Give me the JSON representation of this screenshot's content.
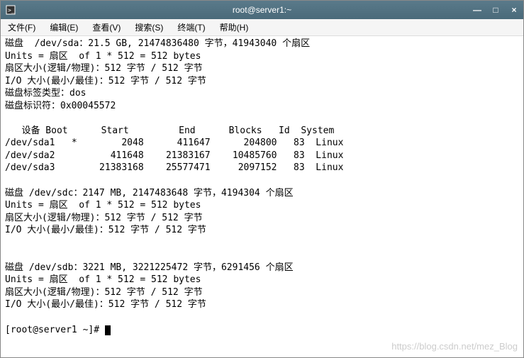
{
  "titlebar": {
    "title": "root@server1:~"
  },
  "menu": {
    "file": "文件(F)",
    "edit": "编辑(E)",
    "view": "查看(V)",
    "search": "搜索(S)",
    "terminal": "终端(T)",
    "help": "帮助(H)"
  },
  "terminal_lines": {
    "l0": "磁盘  /dev/sda：21.5 GB, 21474836480 字节，41943040 个扇区",
    "l1": "Units = 扇区  of 1 * 512 = 512 bytes",
    "l2": "扇区大小(逻辑/物理)：512 字节 / 512 字节",
    "l3": "I/O 大小(最小/最佳)：512 字节 / 512 字节",
    "l4": "磁盘标签类型：dos",
    "l5": "磁盘标识符：0x00045572",
    "l6": "",
    "l7": "   设备 Boot      Start         End      Blocks   Id  System",
    "l8": "/dev/sda1   *        2048      411647      204800   83  Linux",
    "l9": "/dev/sda2          411648    21383167    10485760   83  Linux",
    "l10": "/dev/sda3        21383168    25577471     2097152   83  Linux",
    "l11": "",
    "l12": "磁盘 /dev/sdc：2147 MB, 2147483648 字节，4194304 个扇区",
    "l13": "Units = 扇区  of 1 * 512 = 512 bytes",
    "l14": "扇区大小(逻辑/物理)：512 字节 / 512 字节",
    "l15": "I/O 大小(最小/最佳)：512 字节 / 512 字节",
    "l16": "",
    "l17": "",
    "l18": "磁盘 /dev/sdb：3221 MB, 3221225472 字节，6291456 个扇区",
    "l19": "Units = 扇区  of 1 * 512 = 512 bytes",
    "l20": "扇区大小(逻辑/物理)：512 字节 / 512 字节",
    "l21": "I/O 大小(最小/最佳)：512 字节 / 512 字节",
    "l22": "",
    "prompt": "[root@server1 ~]# "
  },
  "watermark": "https://blog.csdn.net/mez_Blog"
}
